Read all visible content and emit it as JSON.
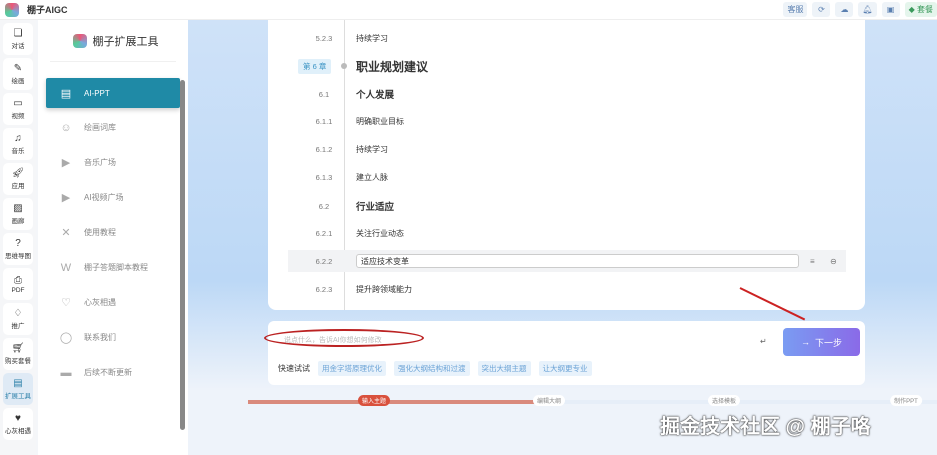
{
  "app": {
    "title": "棚子AIGC"
  },
  "topbar": {
    "service": "客服",
    "package": "套餐"
  },
  "rail": [
    {
      "label": "对话",
      "icon": "chat-icon"
    },
    {
      "label": "绘画",
      "icon": "brush-icon"
    },
    {
      "label": "视频",
      "icon": "video-icon"
    },
    {
      "label": "音乐",
      "icon": "music-icon"
    },
    {
      "label": "应用",
      "icon": "rocket-icon"
    },
    {
      "label": "画廊",
      "icon": "gallery-icon"
    },
    {
      "label": "思维导图",
      "icon": "mindmap-icon"
    },
    {
      "label": "PDF",
      "icon": "pdf-icon"
    },
    {
      "label": "推广",
      "icon": "handshake-icon"
    },
    {
      "label": "购买套餐",
      "icon": "cart-icon"
    },
    {
      "label": "扩展工具",
      "icon": "toolbox-icon"
    },
    {
      "label": "心灰相遇",
      "icon": "heart-icon"
    }
  ],
  "sidebar": {
    "title": "棚子扩展工具",
    "items": [
      {
        "label": "AI-PPT"
      },
      {
        "label": "绘画词库"
      },
      {
        "label": "音乐广场"
      },
      {
        "label": "AI视频广场"
      },
      {
        "label": "使用教程"
      },
      {
        "label": "棚子答题脚本教程"
      },
      {
        "label": "心灰相遇"
      },
      {
        "label": "联系我们"
      },
      {
        "label": "后续不断更新"
      }
    ]
  },
  "outline": [
    {
      "num": "5.2.3",
      "text": "持续学习",
      "level": 3
    },
    {
      "num": "第 6 章",
      "text": "职业规划建议",
      "level": 0
    },
    {
      "num": "6.1",
      "text": "个人发展",
      "level": 2
    },
    {
      "num": "6.1.1",
      "text": "明确职业目标",
      "level": 3
    },
    {
      "num": "6.1.2",
      "text": "持续学习",
      "level": 3
    },
    {
      "num": "6.1.3",
      "text": "建立人脉",
      "level": 3
    },
    {
      "num": "6.2",
      "text": "行业适应",
      "level": 2
    },
    {
      "num": "6.2.1",
      "text": "关注行业动态",
      "level": 3
    },
    {
      "num": "6.2.2",
      "text": "适应技术变革",
      "level": 3,
      "editing": true
    },
    {
      "num": "6.2.3",
      "text": "提升跨领域能力",
      "level": 3
    }
  ],
  "input": {
    "placeholder": "说点什么，告诉AI你想如何修改",
    "next": "下一步",
    "quick_label": "快速试试",
    "chips": [
      "用金字塔原理优化",
      "强化大纲结构和过渡",
      "突出大纲主题",
      "让大纲更专业"
    ]
  },
  "steps": [
    "输入主题",
    "编辑大纲",
    "选择模板",
    "制作PPT"
  ],
  "progress_step": 1,
  "watermark": "掘金技术社区 @ 棚子咯"
}
